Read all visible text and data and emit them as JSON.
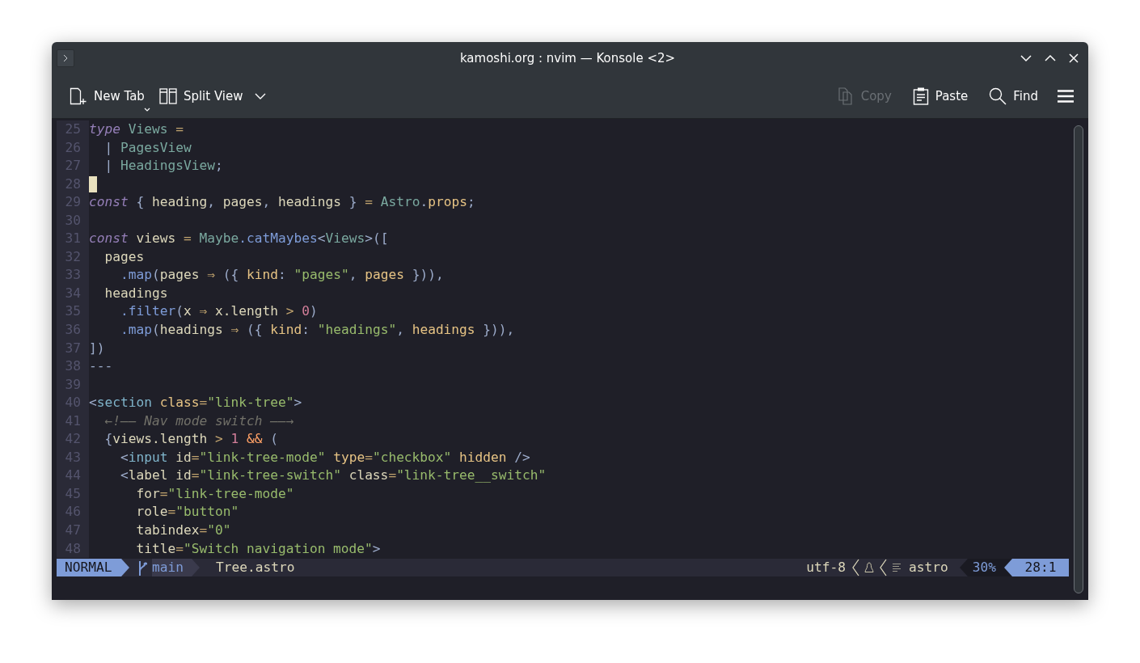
{
  "window": {
    "title": "kamoshi.org : nvim — Konsole <2>"
  },
  "toolbar": {
    "left": [
      {
        "label": "New Tab",
        "disabled": false
      },
      {
        "label": "Split View",
        "disabled": false
      }
    ],
    "right": [
      {
        "label": "Copy",
        "disabled": true
      },
      {
        "label": "Paste",
        "disabled": false
      },
      {
        "label": "Find",
        "disabled": false
      }
    ]
  },
  "editor": {
    "lines": [
      {
        "number": "25",
        "cursor": false,
        "tokens": [
          {
            "text": "type",
            "kind": "kw"
          },
          {
            "text": " Views",
            "kind": "type"
          },
          {
            "text": " =",
            "kind": "op"
          }
        ]
      },
      {
        "number": "26",
        "cursor": false,
        "tokens": [
          {
            "text": "  | ",
            "kind": "punct"
          },
          {
            "text": "PagesView",
            "kind": "type"
          }
        ]
      },
      {
        "number": "27",
        "cursor": false,
        "tokens": [
          {
            "text": "  | ",
            "kind": "punct"
          },
          {
            "text": "HeadingsView",
            "kind": "type"
          },
          {
            "text": ";",
            "kind": "punct"
          }
        ]
      },
      {
        "number": "28",
        "cursor": true
      },
      {
        "number": "29",
        "cursor": false,
        "tokens": [
          {
            "text": "const",
            "kind": "kw"
          },
          {
            "text": " { ",
            "kind": "punct"
          },
          {
            "text": "heading",
            "kind": "plain"
          },
          {
            "text": ", ",
            "kind": "punct"
          },
          {
            "text": "pages",
            "kind": "plain"
          },
          {
            "text": ", ",
            "kind": "punct"
          },
          {
            "text": "headings",
            "kind": "plain"
          },
          {
            "text": " } ",
            "kind": "punct"
          },
          {
            "text": "= ",
            "kind": "op"
          },
          {
            "text": "Astro",
            "kind": "type"
          },
          {
            "text": ".",
            "kind": "punct"
          },
          {
            "text": "props",
            "kind": "prop"
          },
          {
            "text": ";",
            "kind": "punct"
          }
        ]
      },
      {
        "number": "30",
        "cursor": false
      },
      {
        "number": "31",
        "cursor": false,
        "tokens": [
          {
            "text": "const",
            "kind": "kw"
          },
          {
            "text": " views ",
            "kind": "plain"
          },
          {
            "text": "= ",
            "kind": "op"
          },
          {
            "text": "Maybe",
            "kind": "type"
          },
          {
            "text": ".catMaybes",
            "kind": "fn"
          },
          {
            "text": "<",
            "kind": "punct"
          },
          {
            "text": "Views",
            "kind": "type"
          },
          {
            "text": ">([",
            "kind": "punct"
          }
        ]
      },
      {
        "number": "32",
        "cursor": false,
        "tokens": [
          {
            "text": "  pages",
            "kind": "plain"
          }
        ]
      },
      {
        "number": "33",
        "cursor": false,
        "tokens": [
          {
            "text": "    .map",
            "kind": "fn"
          },
          {
            "text": "(",
            "kind": "punct"
          },
          {
            "text": "pages ",
            "kind": "plain"
          },
          {
            "text": "⇒ ",
            "kind": "op"
          },
          {
            "text": "({ ",
            "kind": "punct"
          },
          {
            "text": "kind",
            "kind": "prop"
          },
          {
            "text": ": ",
            "kind": "punct"
          },
          {
            "text": "\"pages\"",
            "kind": "str"
          },
          {
            "text": ", ",
            "kind": "punct"
          },
          {
            "text": "pages",
            "kind": "prop"
          },
          {
            "text": " })),",
            "kind": "punct"
          }
        ]
      },
      {
        "number": "34",
        "cursor": false,
        "tokens": [
          {
            "text": "  headings",
            "kind": "plain"
          }
        ]
      },
      {
        "number": "35",
        "cursor": false,
        "tokens": [
          {
            "text": "    .filter",
            "kind": "fn"
          },
          {
            "text": "(",
            "kind": "punct"
          },
          {
            "text": "x ",
            "kind": "plain"
          },
          {
            "text": "⇒ ",
            "kind": "op"
          },
          {
            "text": "x.length ",
            "kind": "plain"
          },
          {
            "text": "> ",
            "kind": "op"
          },
          {
            "text": "0",
            "kind": "num"
          },
          {
            "text": ")",
            "kind": "punct"
          }
        ]
      },
      {
        "number": "36",
        "cursor": false,
        "tokens": [
          {
            "text": "    .map",
            "kind": "fn"
          },
          {
            "text": "(",
            "kind": "punct"
          },
          {
            "text": "headings ",
            "kind": "plain"
          },
          {
            "text": "⇒ ",
            "kind": "op"
          },
          {
            "text": "({ ",
            "kind": "punct"
          },
          {
            "text": "kind",
            "kind": "prop"
          },
          {
            "text": ": ",
            "kind": "punct"
          },
          {
            "text": "\"headings\"",
            "kind": "str"
          },
          {
            "text": ", ",
            "kind": "punct"
          },
          {
            "text": "headings",
            "kind": "prop"
          },
          {
            "text": " })),",
            "kind": "punct"
          }
        ]
      },
      {
        "number": "37",
        "cursor": false,
        "tokens": [
          {
            "text": "])",
            "kind": "punct"
          }
        ]
      },
      {
        "number": "38",
        "cursor": false,
        "tokens": [
          {
            "text": "---",
            "kind": "punct"
          }
        ]
      },
      {
        "number": "39",
        "cursor": false
      },
      {
        "number": "40",
        "cursor": false,
        "tokens": [
          {
            "text": "<",
            "kind": "punct"
          },
          {
            "text": "section",
            "kind": "tag"
          },
          {
            "text": " class",
            "kind": "prop"
          },
          {
            "text": "=",
            "kind": "op"
          },
          {
            "text": "\"link-tree\"",
            "kind": "str"
          },
          {
            "text": ">",
            "kind": "punct"
          }
        ]
      },
      {
        "number": "41",
        "cursor": false,
        "tokens": [
          {
            "text": "  ←!—— Nav mode switch ——→",
            "kind": "comment"
          }
        ]
      },
      {
        "number": "42",
        "cursor": false,
        "tokens": [
          {
            "text": "  {",
            "kind": "punct"
          },
          {
            "text": "views.length ",
            "kind": "plain"
          },
          {
            "text": "> ",
            "kind": "op"
          },
          {
            "text": "1",
            "kind": "num"
          },
          {
            "text": " && ",
            "kind": "special"
          },
          {
            "text": "(",
            "kind": "punct"
          }
        ]
      },
      {
        "number": "43",
        "cursor": false,
        "tokens": [
          {
            "text": "    <",
            "kind": "punct"
          },
          {
            "text": "input",
            "kind": "tag"
          },
          {
            "text": " id",
            "kind": "plain"
          },
          {
            "text": "=",
            "kind": "op"
          },
          {
            "text": "\"link-tree-mode\"",
            "kind": "str"
          },
          {
            "text": " type",
            "kind": "prop"
          },
          {
            "text": "=",
            "kind": "op"
          },
          {
            "text": "\"checkbox\"",
            "kind": "str"
          },
          {
            "text": " hidden",
            "kind": "prop"
          },
          {
            "text": " />",
            "kind": "punct"
          }
        ]
      },
      {
        "number": "44",
        "cursor": false,
        "tokens": [
          {
            "text": "    <",
            "kind": "punct"
          },
          {
            "text": "label id",
            "kind": "plain"
          },
          {
            "text": "=",
            "kind": "op"
          },
          {
            "text": "\"link-tree-switch\"",
            "kind": "str"
          },
          {
            "text": " class",
            "kind": "plain"
          },
          {
            "text": "=",
            "kind": "op"
          },
          {
            "text": "\"link-tree__switch\"",
            "kind": "str"
          }
        ]
      },
      {
        "number": "45",
        "cursor": false,
        "tokens": [
          {
            "text": "      for",
            "kind": "plain"
          },
          {
            "text": "=",
            "kind": "op"
          },
          {
            "text": "\"link-tree-mode\"",
            "kind": "str"
          }
        ]
      },
      {
        "number": "46",
        "cursor": false,
        "tokens": [
          {
            "text": "      role",
            "kind": "plain"
          },
          {
            "text": "=",
            "kind": "op"
          },
          {
            "text": "\"button\"",
            "kind": "str"
          }
        ]
      },
      {
        "number": "47",
        "cursor": false,
        "tokens": [
          {
            "text": "      tabindex",
            "kind": "plain"
          },
          {
            "text": "=",
            "kind": "op"
          },
          {
            "text": "\"0\"",
            "kind": "str"
          }
        ]
      },
      {
        "number": "48",
        "cursor": false,
        "tokens": [
          {
            "text": "      title",
            "kind": "plain"
          },
          {
            "text": "=",
            "kind": "op"
          },
          {
            "text": "\"Switch navigation mode\"",
            "kind": "str"
          },
          {
            "text": ">",
            "kind": "punct"
          }
        ]
      }
    ]
  },
  "status_line": {
    "mode": "NORMAL",
    "branch": "main",
    "file": "Tree.astro",
    "encoding": "utf-8",
    "filetype": "astro",
    "progress": "30%",
    "position": "28:1"
  }
}
